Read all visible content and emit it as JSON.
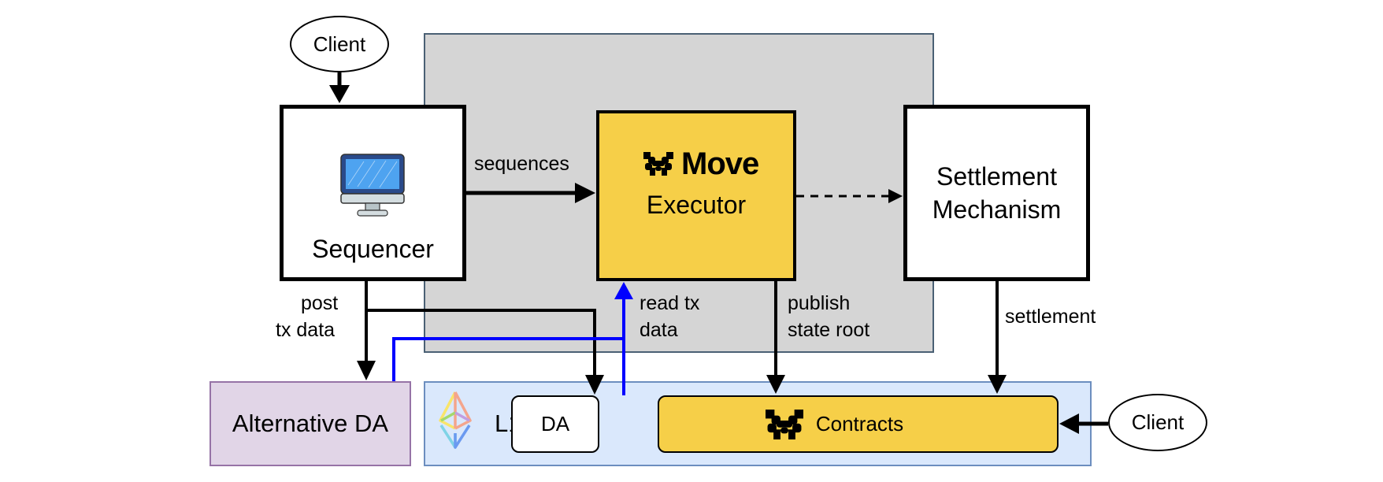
{
  "diagram": {
    "nodes": {
      "client_top": {
        "label": "Client"
      },
      "client_right": {
        "label": "Client"
      },
      "sequencer": {
        "label": "Sequencer",
        "icon": "monitor-icon"
      },
      "executor": {
        "brand": "Move",
        "label": "Executor",
        "icon": "move-logo-icon"
      },
      "settlement": {
        "line1": "Settlement",
        "line2": "Mechanism"
      },
      "alt_da": {
        "label": "Alternative DA"
      },
      "l1": {
        "label": "L1",
        "icon": "ethereum-icon"
      },
      "da": {
        "label": "DA"
      },
      "contracts": {
        "label": "Contracts",
        "icon": "move-logo-icon"
      }
    },
    "edges": {
      "sequences": {
        "label": "sequences"
      },
      "post_tx": {
        "line1": "post",
        "line2": "tx data"
      },
      "read_tx": {
        "line1": "read tx",
        "line2": "data"
      },
      "publish": {
        "line1": "publish",
        "line2": "state root"
      },
      "settlement": {
        "label": "settlement"
      }
    },
    "colors": {
      "gray_region": "#d5d5d5",
      "gray_border": "#4a6074",
      "executor_fill": "#f6cf48",
      "alt_da_fill": "#e1d5e7",
      "alt_da_border": "#9673a6",
      "l1_fill": "#dae8fc",
      "l1_border": "#6c8ebf",
      "blue_line": "#0000ff"
    }
  }
}
